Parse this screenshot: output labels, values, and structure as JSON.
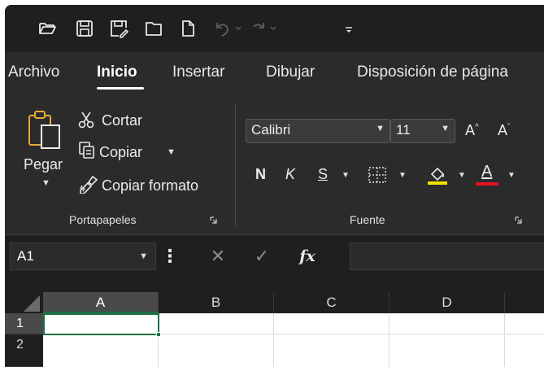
{
  "quick_access": {
    "icons": [
      "open-folder-icon",
      "save-icon",
      "save-as-icon",
      "folder-icon",
      "new-document-icon",
      "undo-icon",
      "redo-icon",
      "customize-qat-icon"
    ]
  },
  "tabs": [
    {
      "label": "Archivo",
      "active": false
    },
    {
      "label": "Inicio",
      "active": true
    },
    {
      "label": "Insertar",
      "active": false
    },
    {
      "label": "Dibujar",
      "active": false
    },
    {
      "label": "Disposición de página",
      "active": false
    }
  ],
  "ribbon": {
    "clipboard": {
      "paste_label": "Pegar",
      "cut_label": "Cortar",
      "copy_label": "Copiar",
      "format_painter_label": "Copiar formato",
      "group_label": "Portapapeles"
    },
    "font": {
      "font_name": "Calibri",
      "font_size": "11",
      "grow_label": "A",
      "shrink_label": "A",
      "bold_label": "N",
      "italic_label": "K",
      "underline_label": "S",
      "fill_color_label": "",
      "font_color_label": "A",
      "group_label": "Fuente",
      "fill_color": "#f2e100",
      "font_color": "#e81123"
    }
  },
  "formula_bar": {
    "name_box": "A1",
    "cancel_symbol": "✕",
    "enter_symbol": "✓",
    "fx_label": "fx",
    "formula": ""
  },
  "grid": {
    "columns": [
      "A",
      "B",
      "C",
      "D"
    ],
    "rows": [
      "1",
      "2"
    ],
    "active_cell": "A1",
    "accent_color": "#1e7145"
  }
}
